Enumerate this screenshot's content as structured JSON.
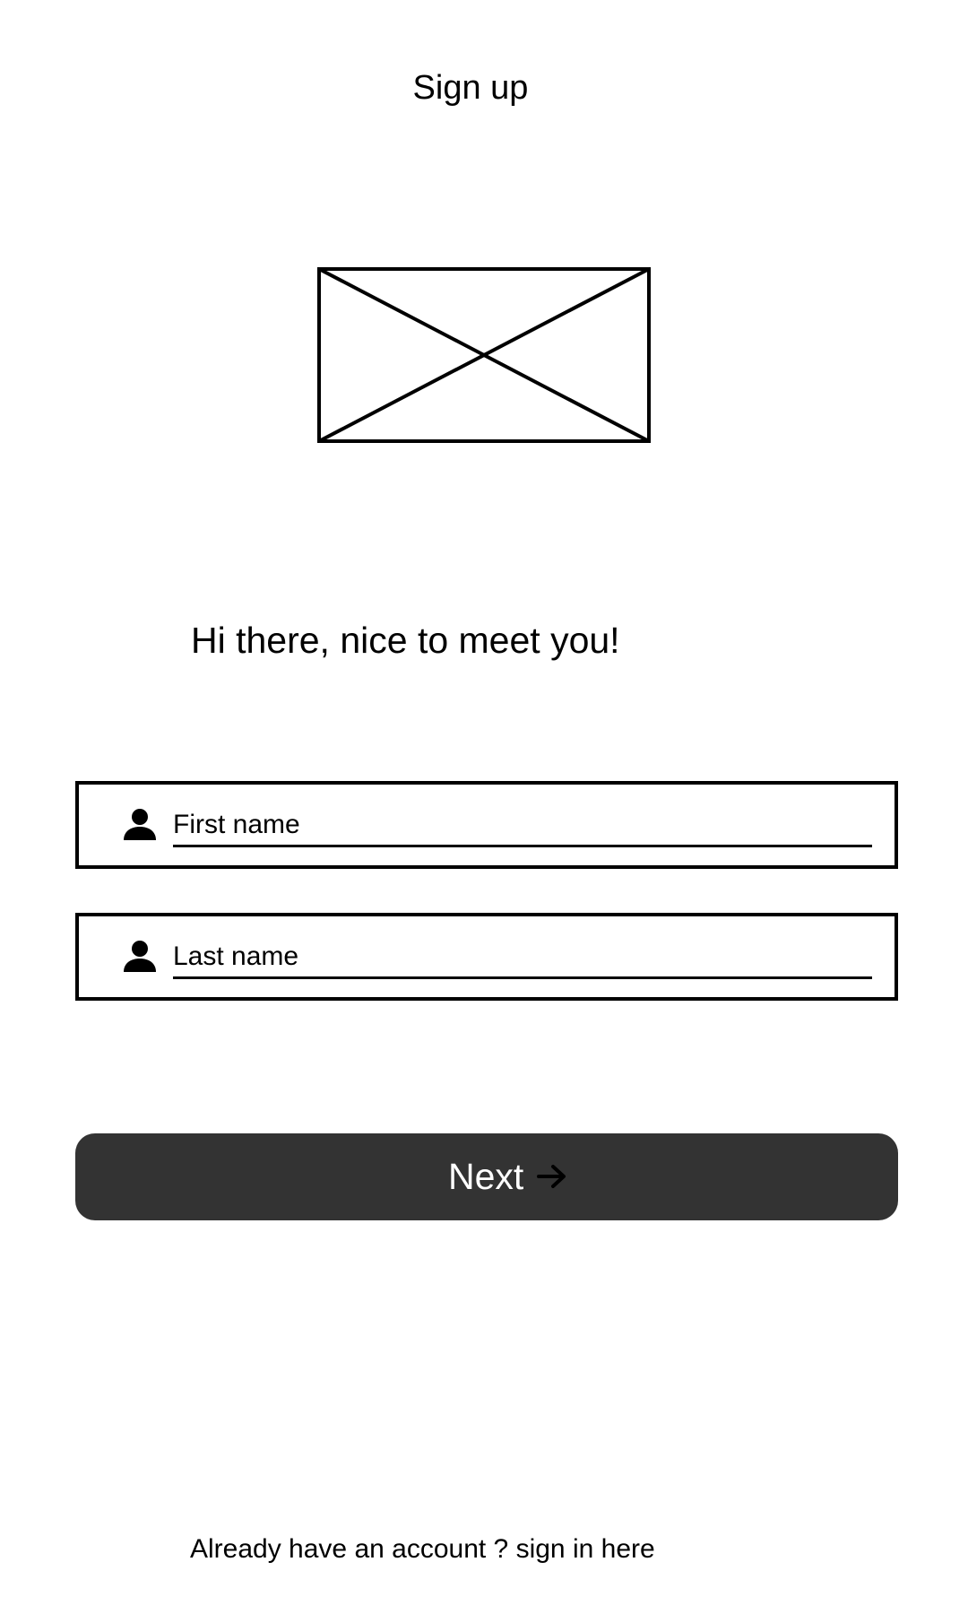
{
  "header": {
    "title": "Sign up"
  },
  "hero": {
    "image_icon": "image-placeholder-icon"
  },
  "greeting": {
    "text": "Hi there, nice to meet you!"
  },
  "form": {
    "first_name": {
      "icon": "person-icon",
      "placeholder": "First name",
      "value": ""
    },
    "last_name": {
      "icon": "person-icon",
      "placeholder": "Last name",
      "value": ""
    }
  },
  "actions": {
    "next_label": "Next",
    "next_icon": "arrow-right-icon",
    "next_color": "#333333"
  },
  "footer": {
    "signin_prompt": "Already have an account ? sign in here"
  }
}
